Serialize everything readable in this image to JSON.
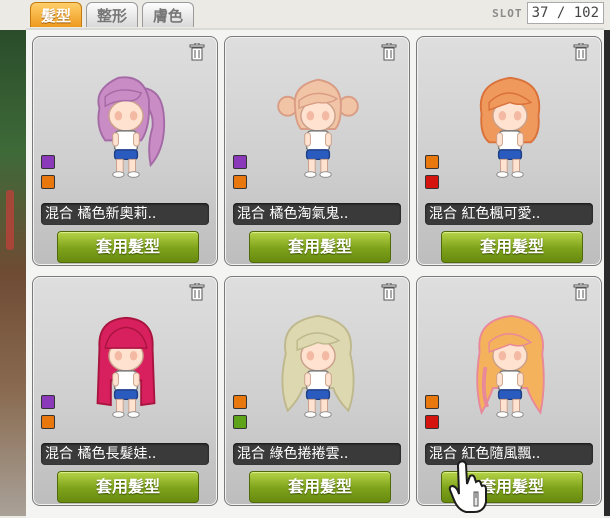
{
  "tabs": [
    {
      "label": "髮型",
      "active": true
    },
    {
      "label": "整形",
      "active": false
    },
    {
      "label": "膚色",
      "active": false
    }
  ],
  "slot": {
    "label": "SLOT",
    "value": "37 / 102"
  },
  "cards": [
    {
      "name": "混合  橘色新奧莉..",
      "button": "套用髮型",
      "colors": [
        "#8a3ab9",
        "#e8770e"
      ],
      "hair": "#c98cc4",
      "hair_dark": "#a46aa6",
      "style": "ponytail"
    },
    {
      "name": "混合  橘色淘氣鬼..",
      "button": "套用髮型",
      "colors": [
        "#8a3ab9",
        "#e8770e"
      ],
      "hair": "#f2c4a6",
      "hair_dark": "#d99c84",
      "style": "pigtails"
    },
    {
      "name": "混合  紅色楓可愛..",
      "button": "套用髮型",
      "colors": [
        "#e8770e",
        "#d4140e"
      ],
      "hair": "#f0995c",
      "hair_dark": "#d9713a",
      "style": "bob"
    },
    {
      "name": "混合  橘色長髮娃..",
      "button": "套用髮型",
      "colors": [
        "#8a3ab9",
        "#e8770e"
      ],
      "hair": "#d8205e",
      "hair_dark": "#a9143f",
      "style": "hime"
    },
    {
      "name": "混合  綠色捲捲雲..",
      "button": "套用髮型",
      "colors": [
        "#e8770e",
        "#5ea41a"
      ],
      "hair": "#ddd8b0",
      "hair_dark": "#bfb88c",
      "style": "curly"
    },
    {
      "name": "混合  紅色隨風飄..",
      "button": "套用髮型",
      "colors": [
        "#e8770e",
        "#d4140e"
      ],
      "hair": "#f4b25c",
      "hair_dark": "#e8889a",
      "style": "wavy"
    }
  ]
}
